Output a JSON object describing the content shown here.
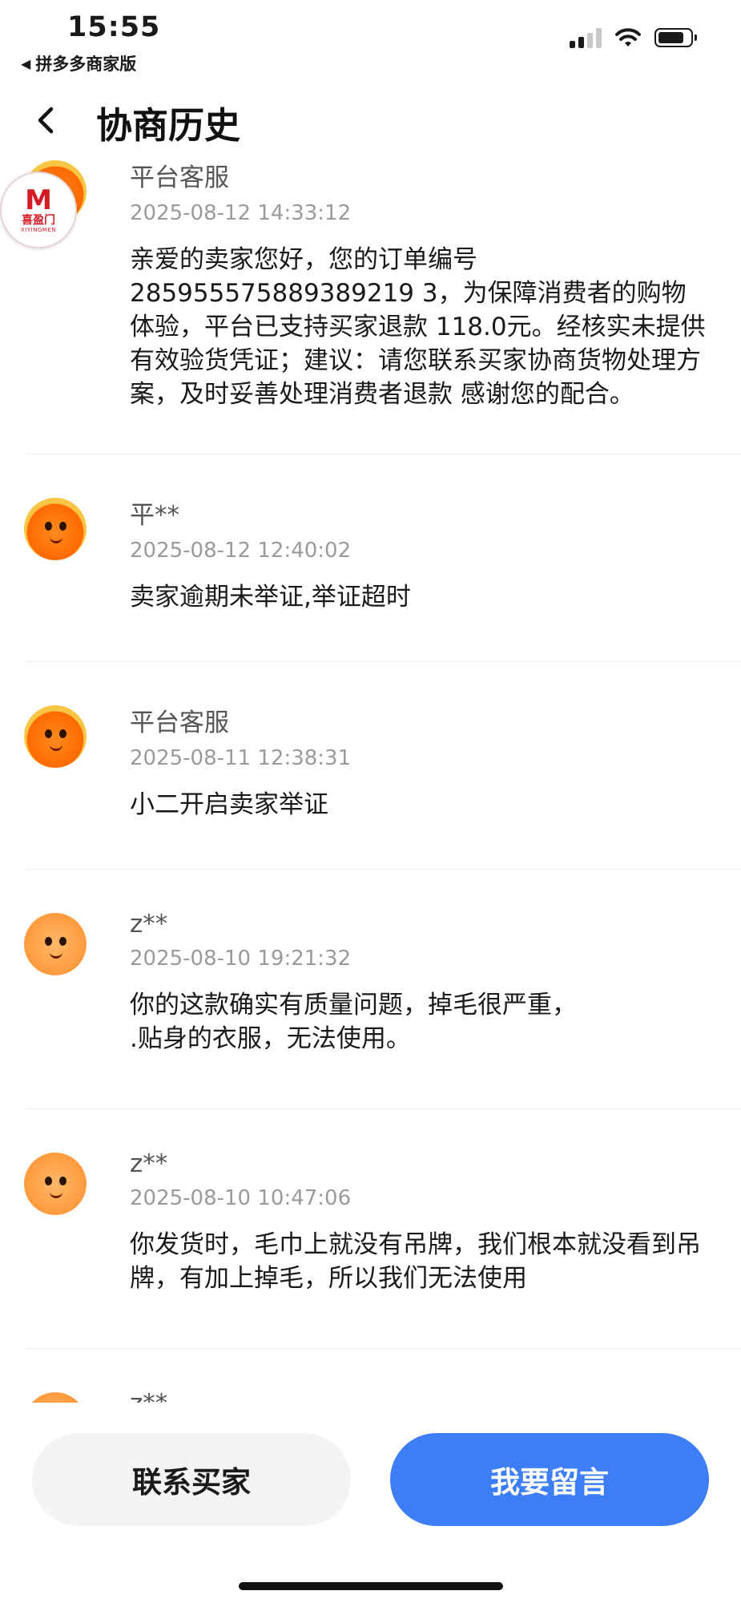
{
  "status_bar": {
    "time": "15:55",
    "back_app": "拼多多商家版"
  },
  "nav": {
    "title": "协商历史"
  },
  "logo": {
    "mark": "M",
    "text_cn": "喜盈门",
    "text_en": "XIYINGMEN"
  },
  "messages": [
    {
      "name": "平台客服",
      "time": "2025-08-12 14:33:12",
      "body": "亲爱的卖家您好，您的订单编号 285955575889389219 3，为保障消费者的购物体验，平台已支持买家退款 118.0元。经核实未提供有效验货凭证；建议：请您联系买家协商货物处理方案，及时妥善处理消费者退款 感谢您的配合。",
      "avatar": "mascot-orange"
    },
    {
      "name": "平**",
      "time": "2025-08-12 12:40:02",
      "body": "卖家逾期未举证,举证超时",
      "avatar": "mascot-orange"
    },
    {
      "name": "平台客服",
      "time": "2025-08-11 12:38:31",
      "body": "小二开启卖家举证",
      "avatar": "mascot-orange"
    },
    {
      "name": "z**",
      "time": "2025-08-10 19:21:32",
      "body": "你的这款确实有质量问题，掉毛很严重，\n.贴身的衣服，无法使用。",
      "avatar": "mascot-chick"
    },
    {
      "name": "z**",
      "time": "2025-08-10 10:47:06",
      "body": "你发货时，毛巾上就没有吊牌，我们根本就没看到吊牌，有加上掉毛，所以我们无法使用",
      "avatar": "mascot-chick"
    },
    {
      "name": "z**",
      "time": "",
      "body": "",
      "avatar": "mascot-chick"
    }
  ],
  "buttons": {
    "contact": "联系买家",
    "leave_message": "我要留言"
  },
  "colors": {
    "primary": "#3d7ef7",
    "secondary_bg": "#f4f4f4"
  }
}
